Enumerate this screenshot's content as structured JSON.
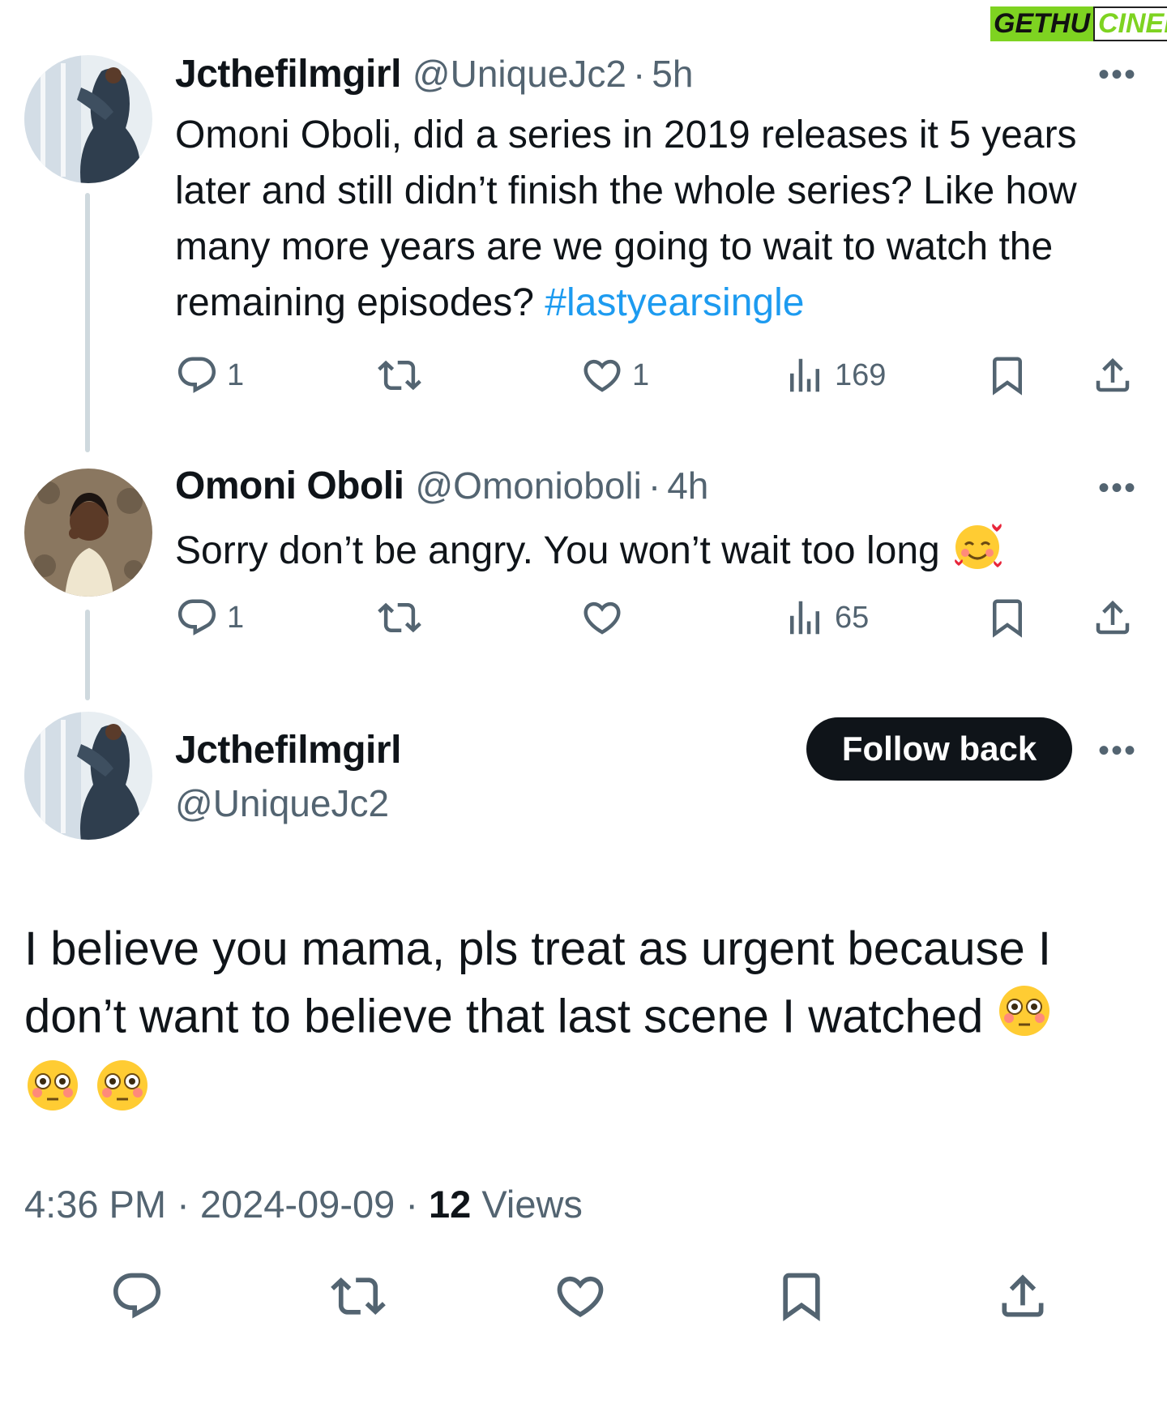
{
  "watermark": {
    "part1": "GETHU",
    "part2": "CINEMA"
  },
  "tweet1": {
    "name": "Jcthefilmgirl",
    "handle": "@UniqueJc2",
    "sep": "·",
    "time": "5h",
    "text": "Omoni Oboli, did a series in 2019 releases it 5 years later and still didn’t finish the whole series? Like how many more years are we going to wait to watch the remaining episodes? ",
    "hashtag": "#lastyearsingle",
    "more": "•••",
    "replies": "1",
    "likes": "1",
    "views": "169"
  },
  "tweet2": {
    "name": "Omoni Oboli",
    "handle": "@Omonioboli",
    "sep": "·",
    "time": "4h",
    "text": "Sorry don’t be angry. You won’t wait too long ",
    "more": "•••",
    "replies": "1",
    "views": "65"
  },
  "tweet3": {
    "name": "Jcthefilmgirl",
    "handle": "@UniqueJc2",
    "follow_label": "Follow back",
    "more": "•••",
    "text": "I believe you mama, pls treat as urgent because I don’t want to believe that last scene I watched ",
    "time": "4:36 PM",
    "sep": "·",
    "date": "2024-09-09",
    "views_count": "12",
    "views_label": "Views"
  },
  "colors": {
    "text": "#0f1419",
    "muted": "#536471",
    "link": "#1d9bf0",
    "line": "#cfd9de"
  },
  "icons": [
    "reply-icon",
    "retweet-icon",
    "like-icon",
    "views-icon",
    "bookmark-icon",
    "share-icon",
    "more-icon",
    "smiling-hearts-emoji",
    "flushed-face-emoji"
  ]
}
